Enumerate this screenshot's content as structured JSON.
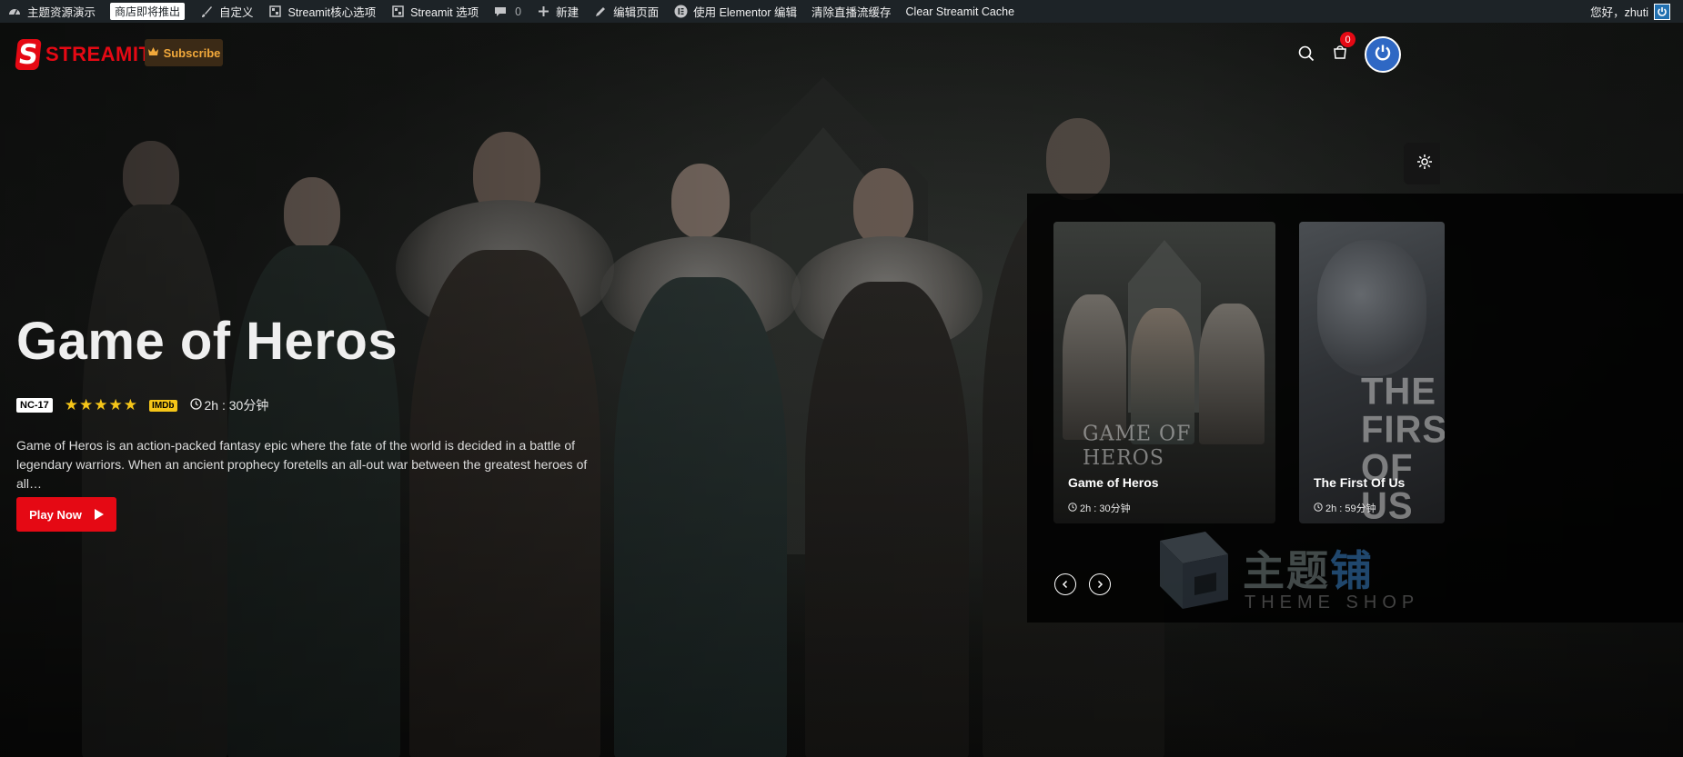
{
  "admin_bar": {
    "items": [
      {
        "icon": "dashboard-icon",
        "label": "主题资源演示"
      },
      {
        "label": "商店即将推出",
        "badge": true
      },
      {
        "icon": "brush-icon",
        "label": "自定义"
      },
      {
        "icon": "settings-box-icon",
        "label": "Streamit核心选项"
      },
      {
        "icon": "settings-box-icon",
        "label": "Streamit 选项"
      },
      {
        "icon": "comment-icon",
        "label": "0"
      },
      {
        "icon": "plus-icon",
        "label": "新建"
      },
      {
        "icon": "pencil-icon",
        "label": "编辑页面"
      },
      {
        "icon": "elementor-icon",
        "label": "使用 Elementor 编辑"
      },
      {
        "label": "清除直播流缓存"
      },
      {
        "label": "Clear Streamit Cache"
      }
    ],
    "greeting": "您好，zhuti"
  },
  "header": {
    "logo_text": "STREAMIT",
    "logo_letter": "S",
    "subscribe_label": "Subscribe",
    "cart_count": "0",
    "icons": [
      "search-icon",
      "cart-icon",
      "power-icon",
      "gear-icon"
    ]
  },
  "hero": {
    "title": "Game of Heros",
    "age_rating": "NC-17",
    "stars": 5,
    "imdb_label": "IMDb",
    "duration": "2h : 30分钟",
    "description": "Game of Heros is an action-packed fantasy epic where the fate of the world is decided in a battle of legendary warriors. When an ancient prophecy foretells an all-out war between the greatest heroes of all…",
    "play_label": "Play Now"
  },
  "slider": {
    "cards": [
      {
        "title": "Game of Heros",
        "duration": "2h : 30分钟",
        "poster_text": "GAME OF HEROS"
      },
      {
        "title": "The First Of Us",
        "duration": "2h : 59分钟",
        "poster_text": "THE FIRST OF US"
      }
    ]
  },
  "watermark": {
    "cn_text_gray": "主题",
    "cn_text_blue": "铺",
    "en_text": "THEME SHOP"
  },
  "colors": {
    "brand_red": "#e50914",
    "admin_bg": "#1d2327",
    "subscribe_gold": "#f2a93b",
    "star_gold": "#f5c518",
    "user_blue": "#2f68c4"
  }
}
